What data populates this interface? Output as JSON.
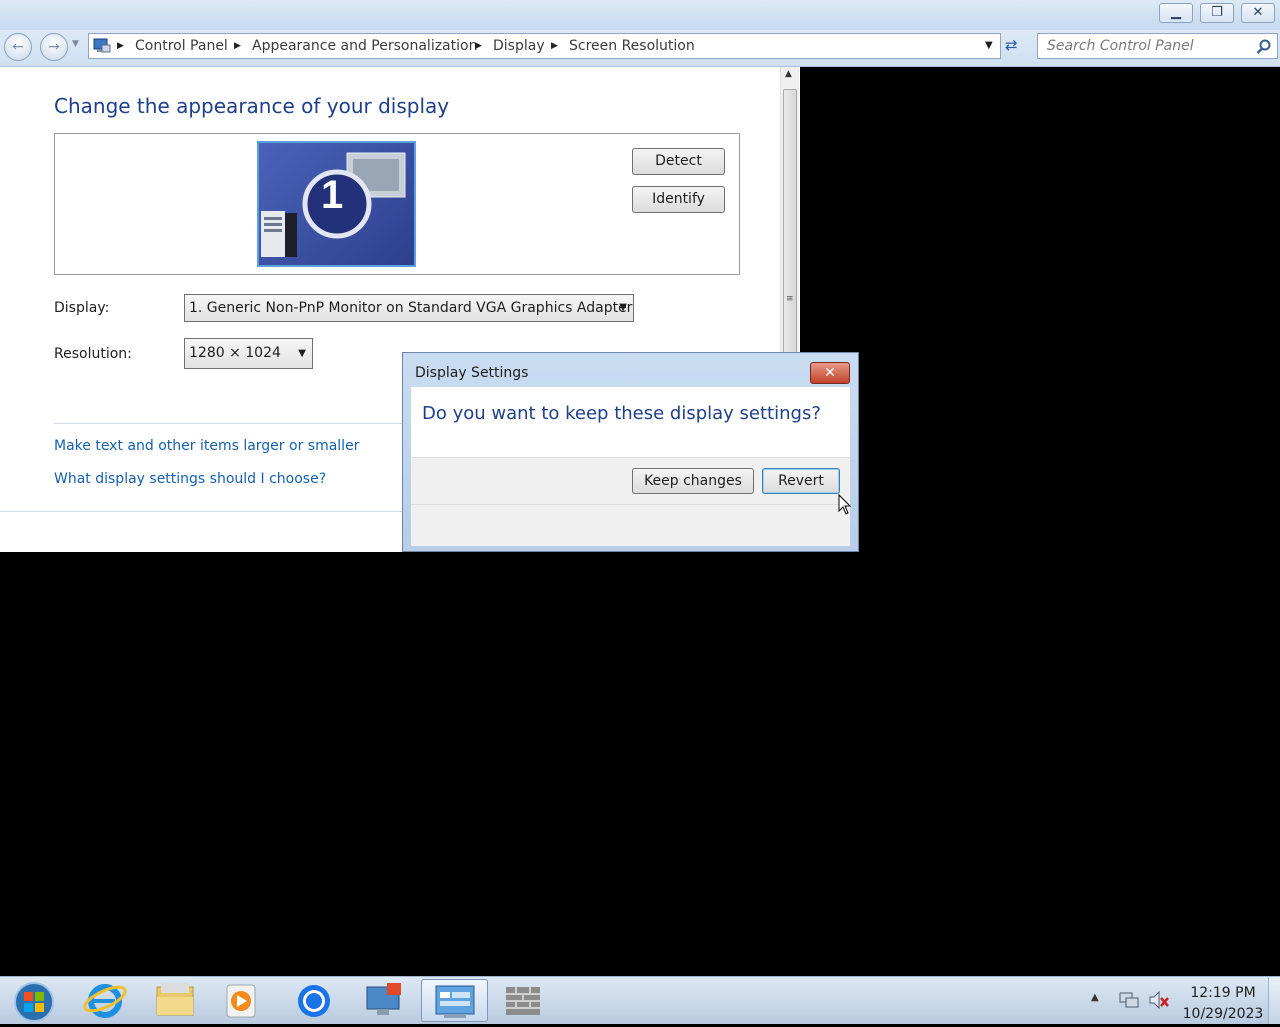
{
  "window": {
    "minimize_icon": "minimize-icon",
    "restore_icon": "restore-icon",
    "close_icon": "close-icon"
  },
  "address_bar": {
    "breadcrumbs": [
      "Control Panel",
      "Appearance and Personalization",
      "Display",
      "Screen Resolution"
    ],
    "search_placeholder": "Search Control Panel"
  },
  "main": {
    "heading": "Change the appearance of your display",
    "monitor_number": "1",
    "detect_label": "Detect",
    "identify_label": "Identify",
    "display_label": "Display:",
    "display_value": "1. Generic Non-PnP Monitor on Standard VGA Graphics Adapter",
    "resolution_label": "Resolution:",
    "resolution_value": "1280 × 1024",
    "links": [
      "Make text and other items larger or smaller",
      "What display settings should I choose?"
    ]
  },
  "dialog": {
    "title": "Display Settings",
    "question": "Do you want to keep these display settings?",
    "keep_label": "Keep changes",
    "revert_label": "Revert"
  },
  "taskbar": {
    "time": "12:19 PM",
    "date": "10/29/2023",
    "items": [
      "start-orb",
      "internet-explorer",
      "file-explorer",
      "media-player",
      "chrome",
      "remote-desktop",
      "control-panel",
      "firewall"
    ]
  },
  "colors": {
    "heading": "#1e3f8a",
    "link": "#1560b0"
  }
}
